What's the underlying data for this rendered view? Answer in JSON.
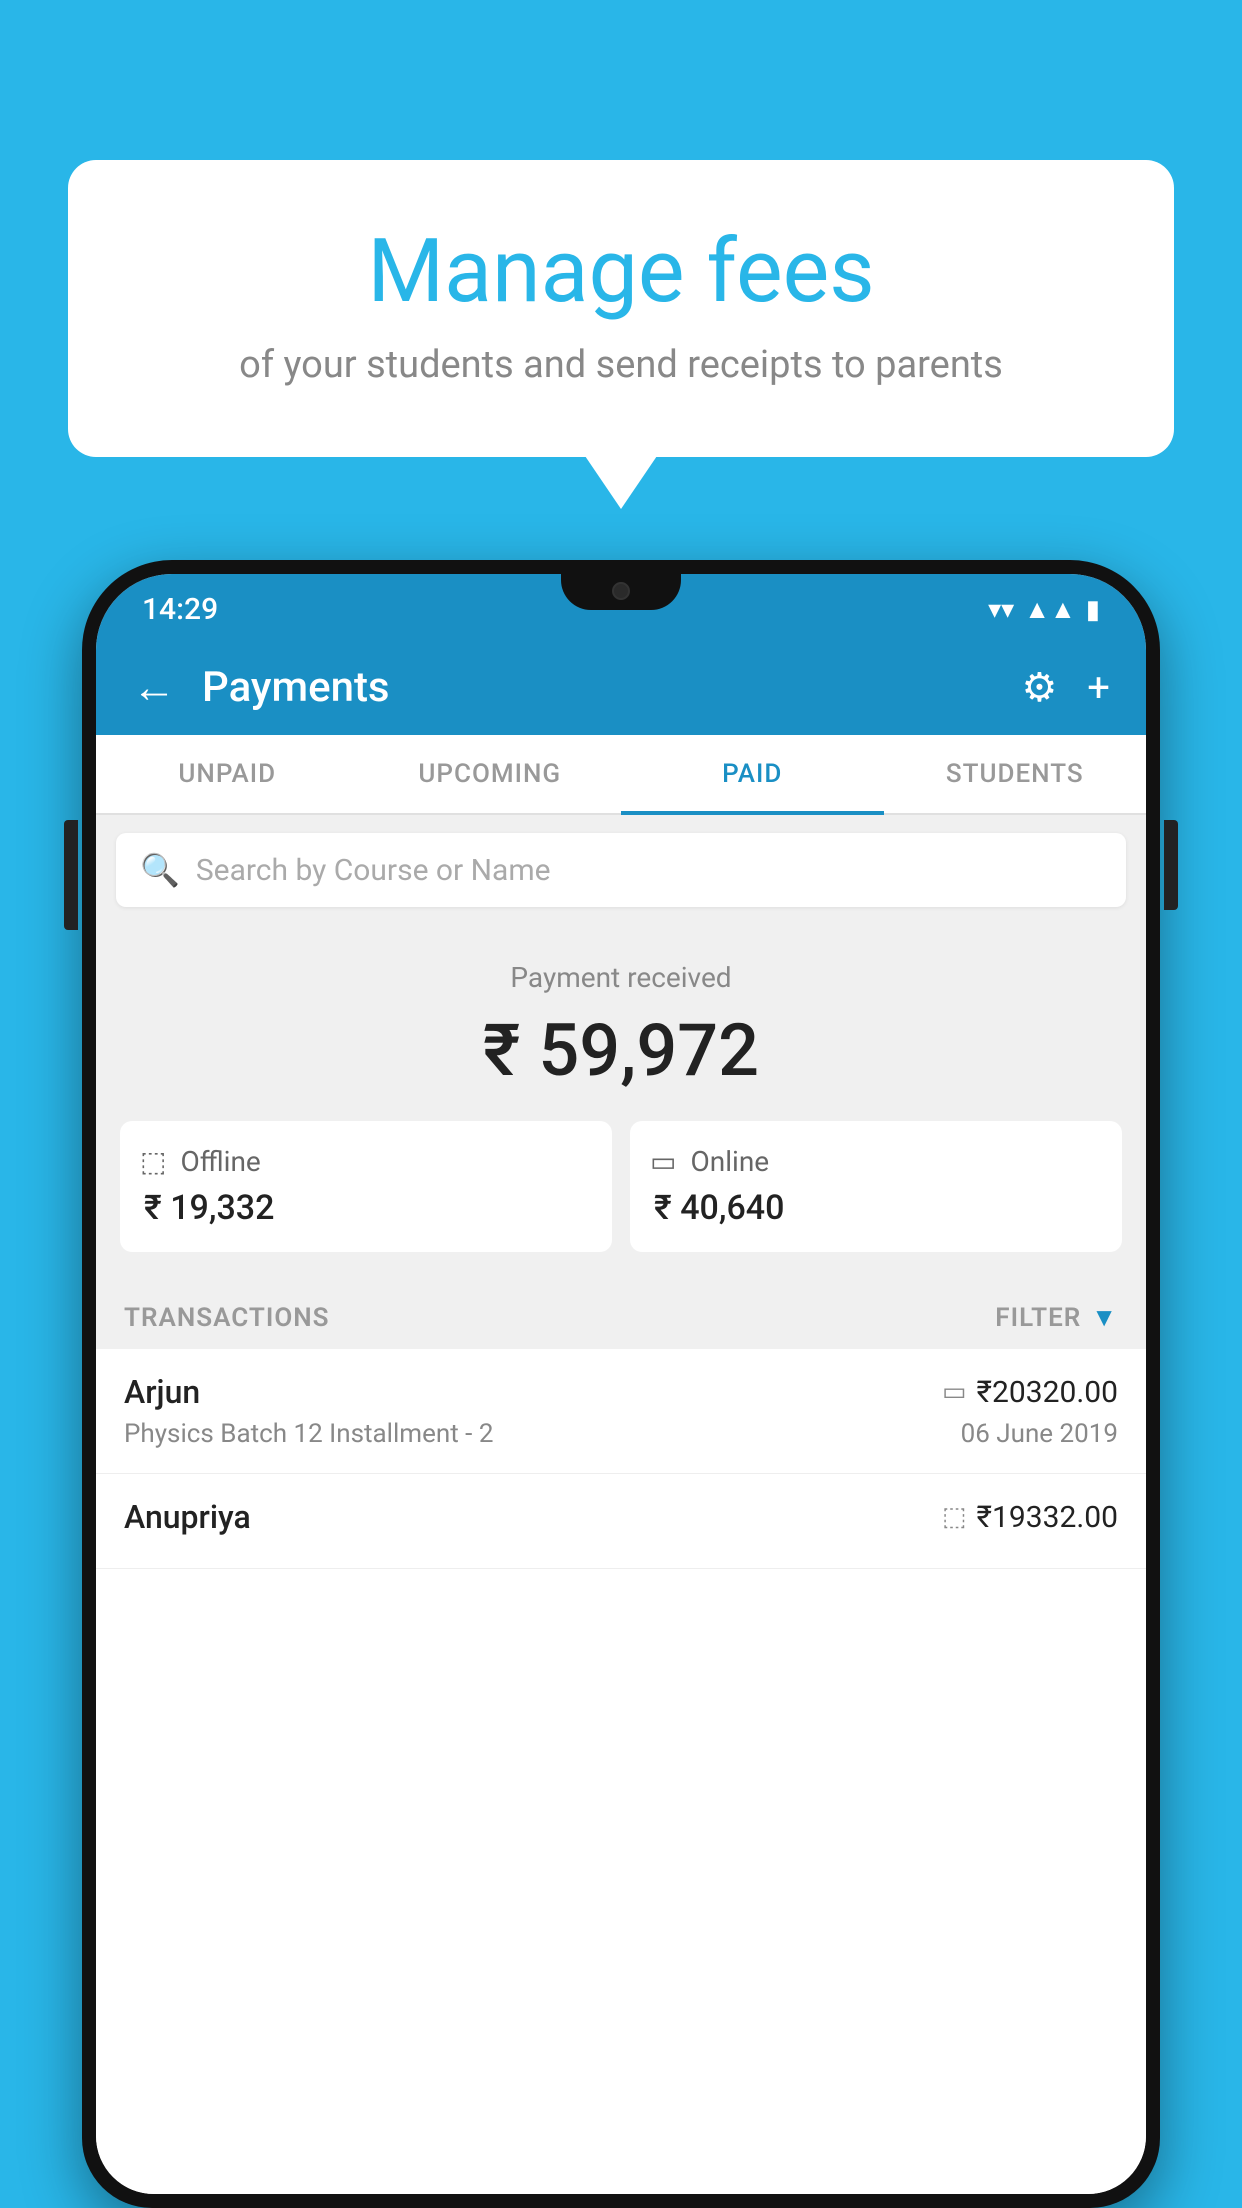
{
  "background_color": "#29b6e8",
  "bubble": {
    "title": "Manage fees",
    "subtitle": "of your students and send receipts to parents"
  },
  "status_bar": {
    "time": "14:29",
    "icons": [
      "wifi",
      "signal",
      "battery"
    ]
  },
  "header": {
    "title": "Payments",
    "back_label": "←",
    "settings_label": "⚙",
    "add_label": "+"
  },
  "tabs": [
    {
      "label": "UNPAID",
      "active": false
    },
    {
      "label": "UPCOMING",
      "active": false
    },
    {
      "label": "PAID",
      "active": true
    },
    {
      "label": "STUDENTS",
      "active": false
    }
  ],
  "search": {
    "placeholder": "Search by Course or Name"
  },
  "payment_summary": {
    "label": "Payment received",
    "total": "₹ 59,972",
    "offline": {
      "type": "Offline",
      "amount": "₹ 19,332"
    },
    "online": {
      "type": "Online",
      "amount": "₹ 40,640"
    }
  },
  "transactions": {
    "section_label": "TRANSACTIONS",
    "filter_label": "FILTER",
    "rows": [
      {
        "name": "Arjun",
        "course": "Physics Batch 12 Installment - 2",
        "amount": "₹20320.00",
        "date": "06 June 2019",
        "payment_type": "online"
      },
      {
        "name": "Anupriya",
        "course": "",
        "amount": "₹19332.00",
        "date": "",
        "payment_type": "offline"
      }
    ]
  }
}
